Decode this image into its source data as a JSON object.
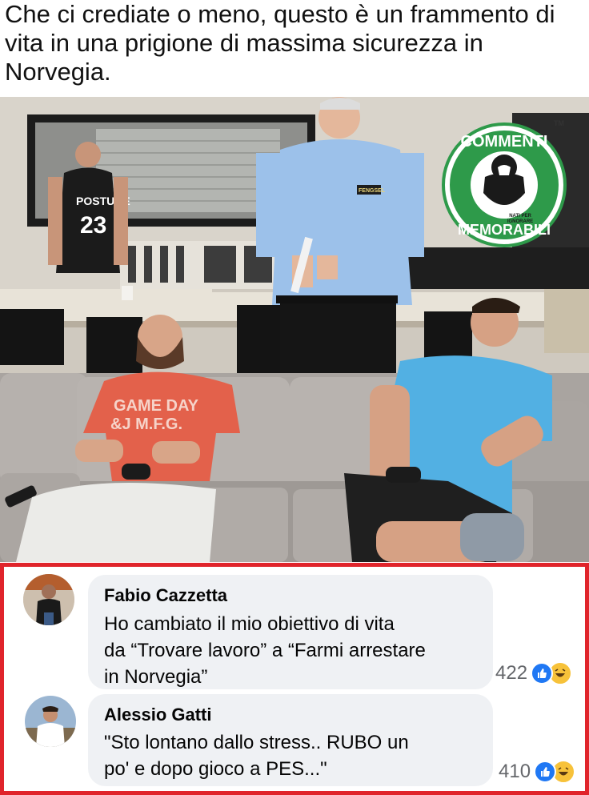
{
  "post": {
    "caption": "Che ci crediate o meno, questo è un frammento di vita in una prigione di massima sicurezza in Norvegia."
  },
  "photo": {
    "jersey_text": "POSTURE",
    "jersey_number": "23",
    "shirt_text_line1": "GAME DAY",
    "shirt_text_line2": "&J M.F.G.",
    "badge_text": "FENGSEL",
    "logo": {
      "top_text": "COMMENTI",
      "bottom_text": "MEMORABILI",
      "tagline_1": "NATI PER",
      "tagline_2": "IGNORARE",
      "tm": "TM",
      "color": "#2e9a4a"
    }
  },
  "comments": [
    {
      "author": "Fabio Cazzetta",
      "line1": "Ho cambiato il mio obiettivo di vita",
      "line2": "da “Trovare lavoro” a “Farmi arrestare",
      "line3": "in Norvegia”",
      "reactions_count": "422",
      "reaction_icons": [
        "like-icon",
        "haha-icon"
      ]
    },
    {
      "author": "Alessio Gatti",
      "line1": "\"Sto lontano dallo stress.. RUBO un",
      "line2": "po' e dopo gioco a PES...\"",
      "reactions_count": "410",
      "reaction_icons": [
        "like-icon",
        "haha-icon"
      ]
    }
  ],
  "colors": {
    "highlight_border": "#e0242b",
    "bubble_bg": "#eff1f4",
    "like_blue": "#2078f4",
    "haha_yellow": "#f7c23a",
    "count_gray": "#65676b"
  }
}
